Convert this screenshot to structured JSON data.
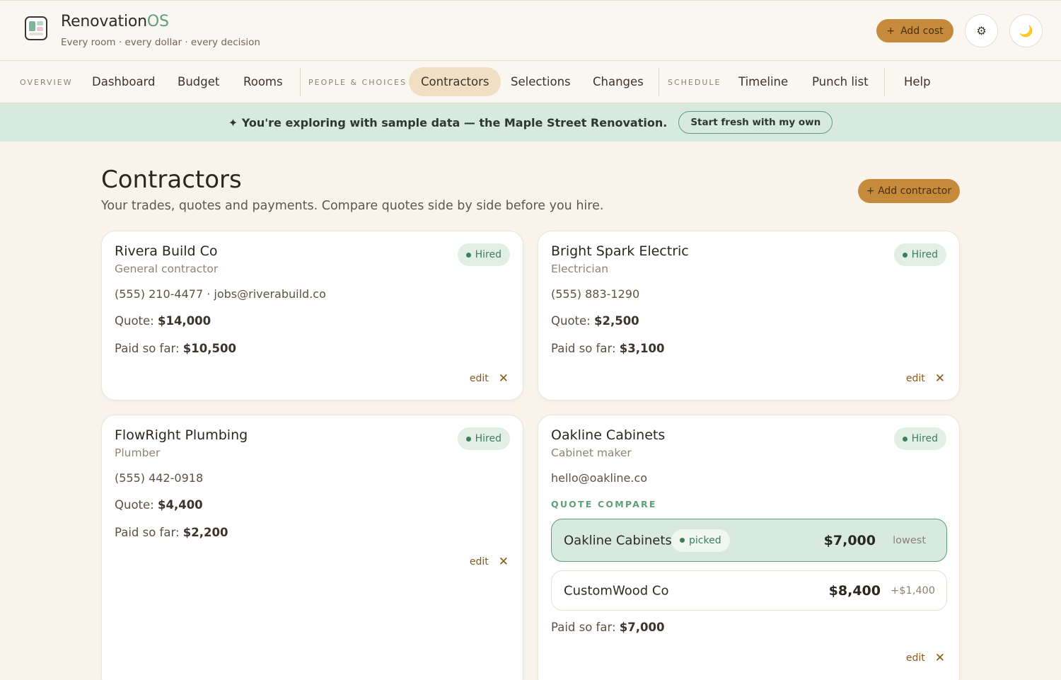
{
  "app": {
    "brand_main": "Renovation",
    "brand_accent": "OS",
    "tagline": "Every room · every dollar · every decision",
    "add_cost_label": "Add cost",
    "settings_icon_glyph": "⚙",
    "theme_icon_glyph": "🌙"
  },
  "nav": {
    "groups": [
      "OVERVIEW",
      "PEOPLE & CHOICES",
      "SCHEDULE"
    ],
    "items": [
      "Dashboard",
      "Budget",
      "Rooms",
      "Contractors",
      "Selections",
      "Changes",
      "Timeline",
      "Punch list",
      "Help"
    ],
    "active": "Contractors"
  },
  "banner": {
    "text": "✦ You're exploring with sample data — the Maple Street Renovation.",
    "button": "Start fresh with my own"
  },
  "page": {
    "title": "Contractors",
    "subtitle": "Your trades, quotes and payments. Compare quotes side by side before you hire.",
    "add_contractor_label": "+ Add contractor"
  },
  "labels": {
    "quote": "Quote:",
    "paid": "Paid so far:",
    "edit": "edit",
    "close": "✕",
    "quote_compare": "QUOTE COMPARE"
  },
  "contractors": [
    {
      "name": "Rivera Build Co",
      "role": "General contractor",
      "status": "Hired",
      "contact": "(555) 210-4477 · jobs@riverabuild.co",
      "quote": "$14,000",
      "paid": "$10,500"
    },
    {
      "name": "Bright Spark Electric",
      "role": "Electrician",
      "status": "Hired",
      "contact": "(555) 883-1290",
      "quote": "$2,500",
      "paid": "$3,100"
    },
    {
      "name": "FlowRight Plumbing",
      "role": "Plumber",
      "status": "Hired",
      "contact": "(555) 442-0918",
      "quote": "$4,400",
      "paid": "$2,200"
    },
    {
      "name": "Oakline Cabinets",
      "role": "Cabinet maker",
      "status": "Hired",
      "contact": "hello@oakline.co",
      "paid": "$7,000",
      "quotes": [
        {
          "name": "Oakline Cabinets",
          "badge": "picked",
          "amount": "$7,000",
          "note": "lowest"
        },
        {
          "name": "CustomWood Co",
          "amount": "$8,400",
          "note": "+$1,400"
        }
      ]
    }
  ],
  "colors": {
    "accent": "#c58a3b",
    "green": "#5f9e7c",
    "banner_bg": "#d8e9df",
    "page_bg": "#f8f4ec"
  }
}
